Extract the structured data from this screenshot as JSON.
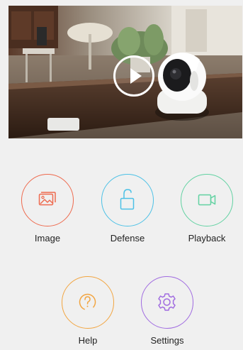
{
  "colors": {
    "image": "#ee6a4e",
    "defense": "#4cc1e6",
    "playback": "#62d2a2",
    "help": "#f2a541",
    "settings": "#a06be0"
  },
  "video": {
    "play_icon": "play-icon"
  },
  "actions": {
    "image": {
      "label": "Image",
      "icon": "image-icon"
    },
    "defense": {
      "label": "Defense",
      "icon": "unlock-icon"
    },
    "playback": {
      "label": "Playback",
      "icon": "video-camera-icon"
    },
    "help": {
      "label": "Help",
      "icon": "question-icon"
    },
    "settings": {
      "label": "Settings",
      "icon": "gear-icon"
    }
  }
}
